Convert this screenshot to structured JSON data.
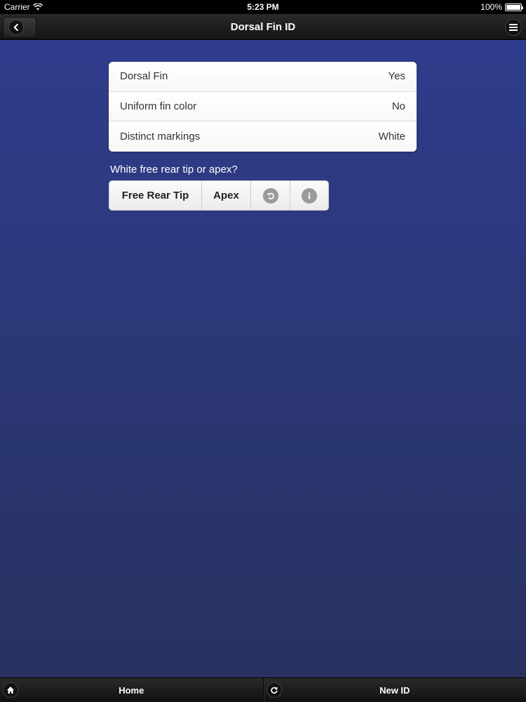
{
  "status_bar": {
    "carrier": "Carrier",
    "time": "5:23 PM",
    "battery": "100%"
  },
  "header": {
    "title": "Dorsal Fin ID",
    "back_icon": "chevron-left-icon",
    "menu_icon": "hamburger-menu-icon"
  },
  "answers": [
    {
      "label": "Dorsal Fin",
      "value": "Yes"
    },
    {
      "label": "Uniform fin color",
      "value": "No"
    },
    {
      "label": "Distinct markings",
      "value": "White"
    }
  ],
  "question": {
    "text": "White free rear tip or apex?",
    "choices": [
      "Free Rear Tip",
      "Apex"
    ],
    "undo_icon": "undo-icon",
    "info_icon": "info-icon"
  },
  "footer": {
    "home_label": "Home",
    "new_id_label": "New ID",
    "home_icon": "home-icon",
    "refresh_icon": "refresh-icon"
  },
  "colors": {
    "background_top": "#2f3c8c",
    "background_bottom": "#283260",
    "bar": "#1a1a1a"
  }
}
